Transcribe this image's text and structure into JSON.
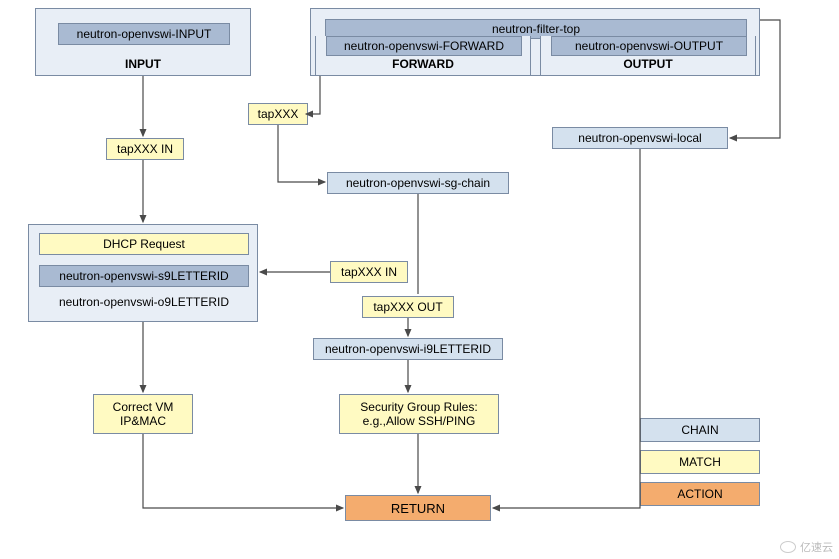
{
  "top": {
    "neutron_filter_top": "neutron-filter-top",
    "input": {
      "label": "INPUT",
      "sub": "neutron-openvswi-INPUT"
    },
    "forward": {
      "label": "FORWARD",
      "sub": "neutron-openvswi-FORWARD"
    },
    "output": {
      "label": "OUTPUT",
      "sub": "neutron-openvswi-OUTPUT"
    }
  },
  "matches": {
    "tapxxx": "tapXXX",
    "tapxxx_in": "tapXXX IN",
    "tapxxx_in2": "tapXXX IN",
    "tapxxx_out": "tapXXX OUT",
    "correct_vm": "Correct VM\nIP&MAC",
    "sg_rules": "Security Group Rules:\ne.g.,Allow SSH/PING"
  },
  "chains": {
    "local": "neutron-openvswi-local",
    "sg_chain": "neutron-openvswi-sg-chain",
    "dhcp": "DHCP Request",
    "s9": "neutron-openvswi-s9LETTERID",
    "o9": "neutron-openvswi-o9LETTERID",
    "i9": "neutron-openvswi-i9LETTERID"
  },
  "action": {
    "return": "RETURN"
  },
  "legend": {
    "chain": "CHAIN",
    "match": "MATCH",
    "action": "ACTION"
  },
  "watermark": "亿速云"
}
